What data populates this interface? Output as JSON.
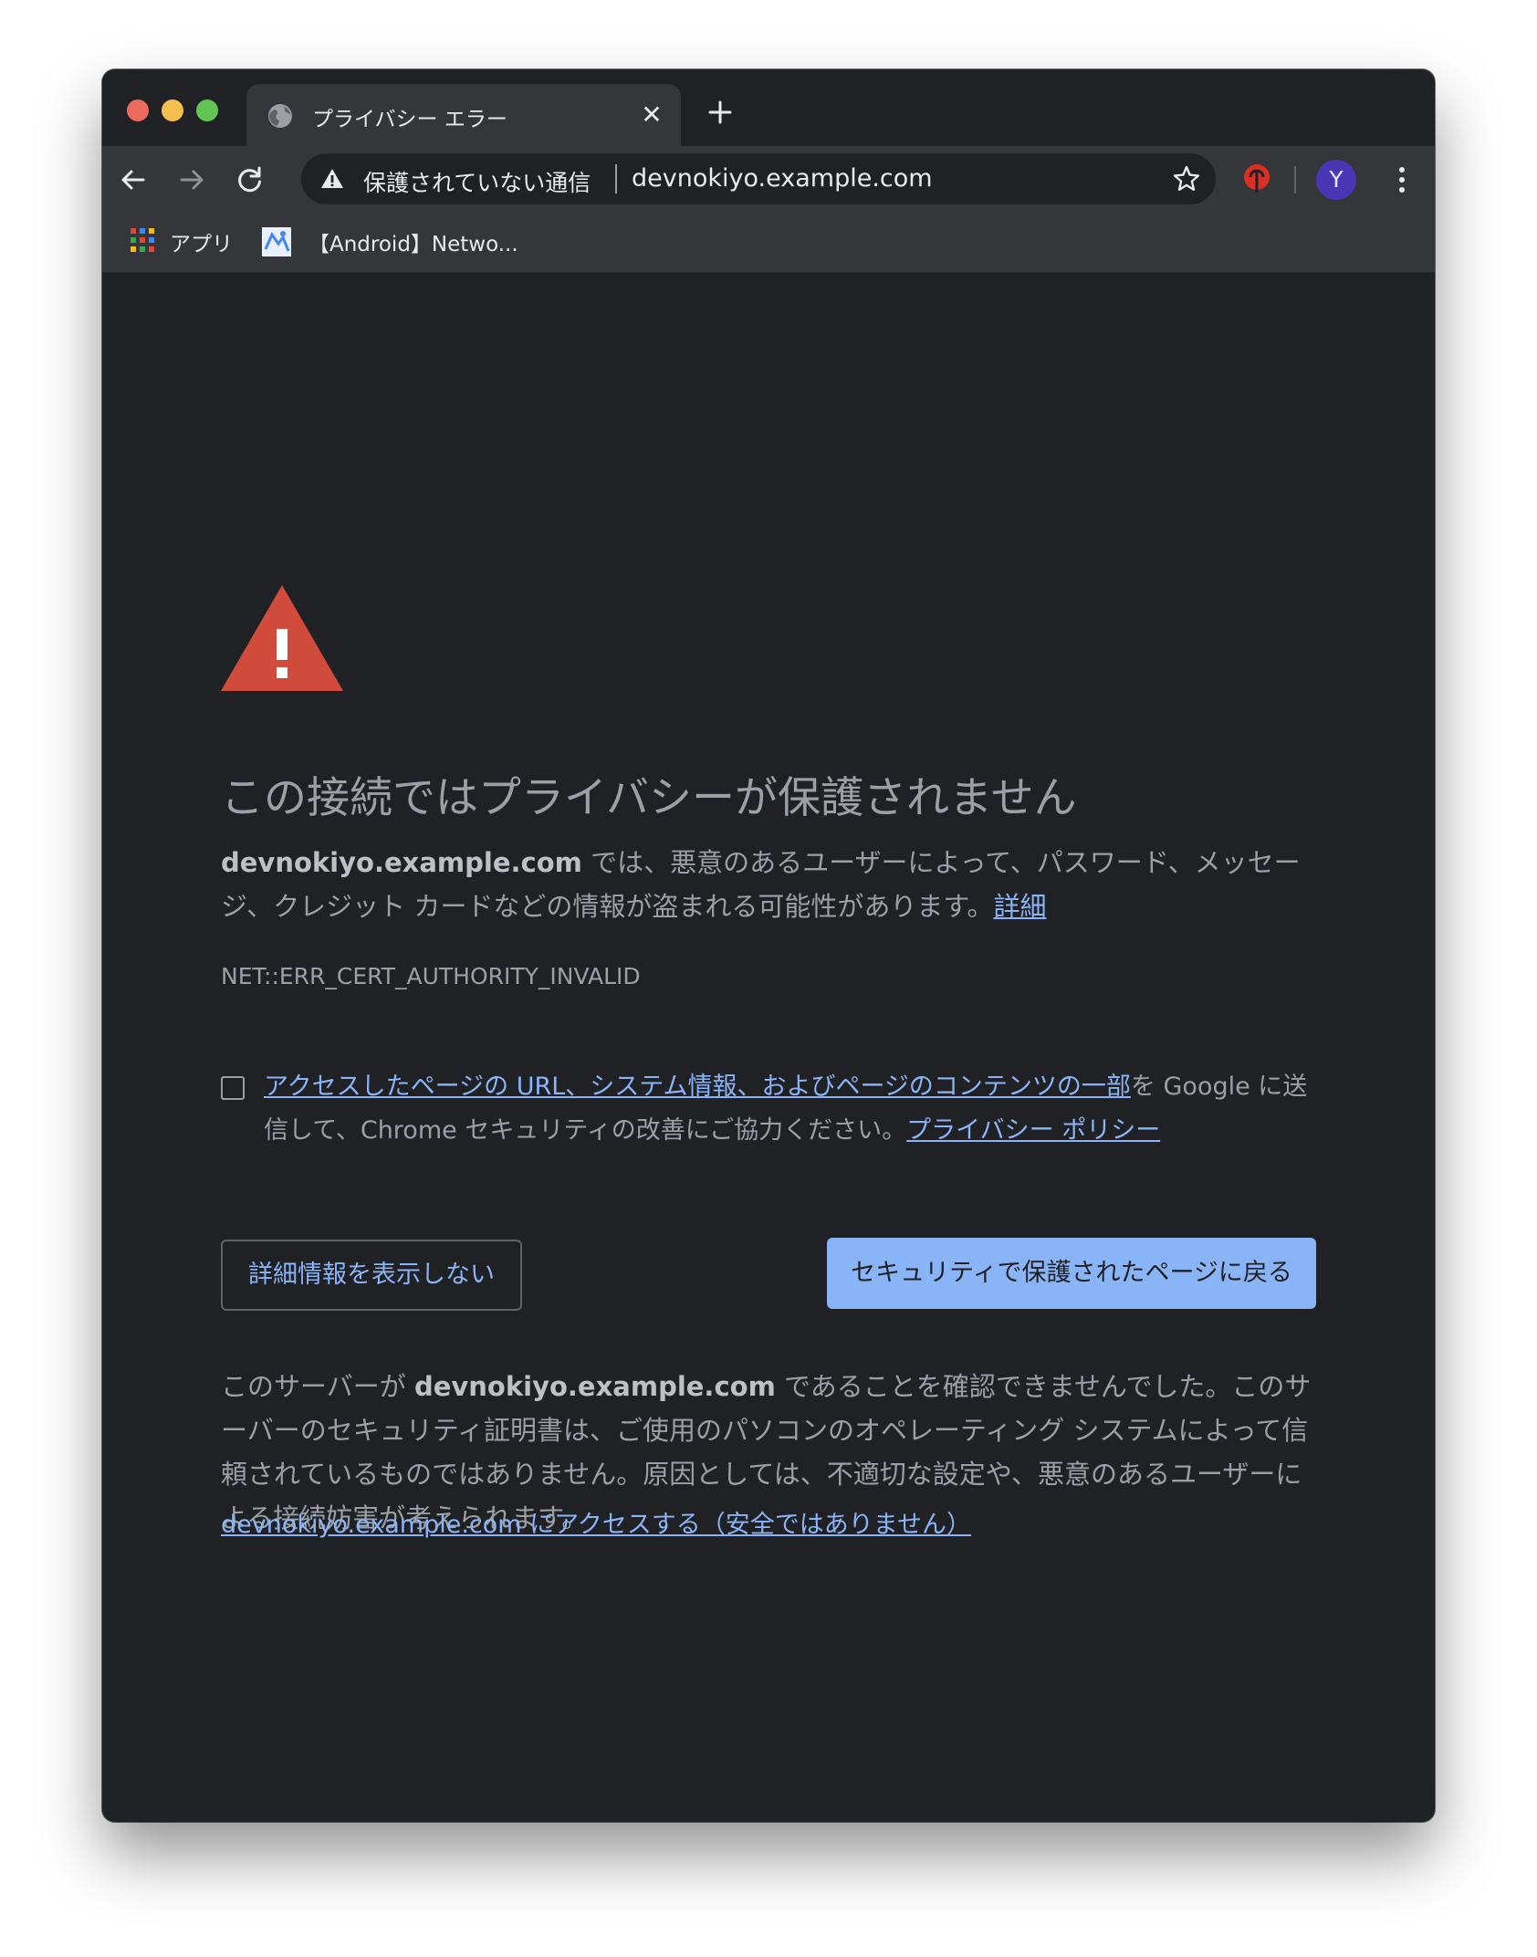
{
  "tab": {
    "title": "プライバシー エラー",
    "close_glyph": "✕"
  },
  "omnibox": {
    "security_label": "保護されていない通信",
    "url": "devnokiyo.example.com"
  },
  "avatar": {
    "initial": "Y",
    "color": "#4a35b5"
  },
  "bookmarks": [
    {
      "label": "アプリ",
      "icon": "apps-grid-icon"
    },
    {
      "label": "【Android】Netwo...",
      "icon": "bookmark-favicon"
    }
  ],
  "page": {
    "heading": "この接続ではプライバシーが保護されません",
    "p1_host": "devnokiyo.example.com",
    "p1_text": " では、悪意のあるユーザーによって、パスワード、メッセージ、クレジット カードなどの情報が盗まれる可能性があります。",
    "p1_link": "詳細",
    "error_code": "NET::ERR_CERT_AUTHORITY_INVALID",
    "optin_link": "アクセスしたページの URL、システム情報、およびページのコンテンツの一部",
    "optin_text": "を Google に送信して、Chrome セキュリティの改善にご協力ください。",
    "optin_privacy_link": "プライバシー ポリシー",
    "btn_details": "詳細情報を表示しない",
    "btn_back": "セキュリティで保護されたページに戻る",
    "p4_before": "このサーバーが ",
    "p4_host": "devnokiyo.example.com",
    "p4_after": " であることを確認できませんでした。このサーバーのセキュリティ証明書は、ご使用のパソコンのオペレーティング システムによって信頼されているものではありません。原因としては、不適切な設定や、悪意のあるユーザーによる接続妨害が考えられます。",
    "proceed_link": "devnokiyo.example.com にアクセスする（安全ではありません）"
  },
  "colors": {
    "background": "#202124",
    "toolbar": "#35363a",
    "text": "#9aa0a6",
    "link": "#8ab4f8",
    "alert": "#d04b3b",
    "button_primary": "#8ab4f8"
  }
}
